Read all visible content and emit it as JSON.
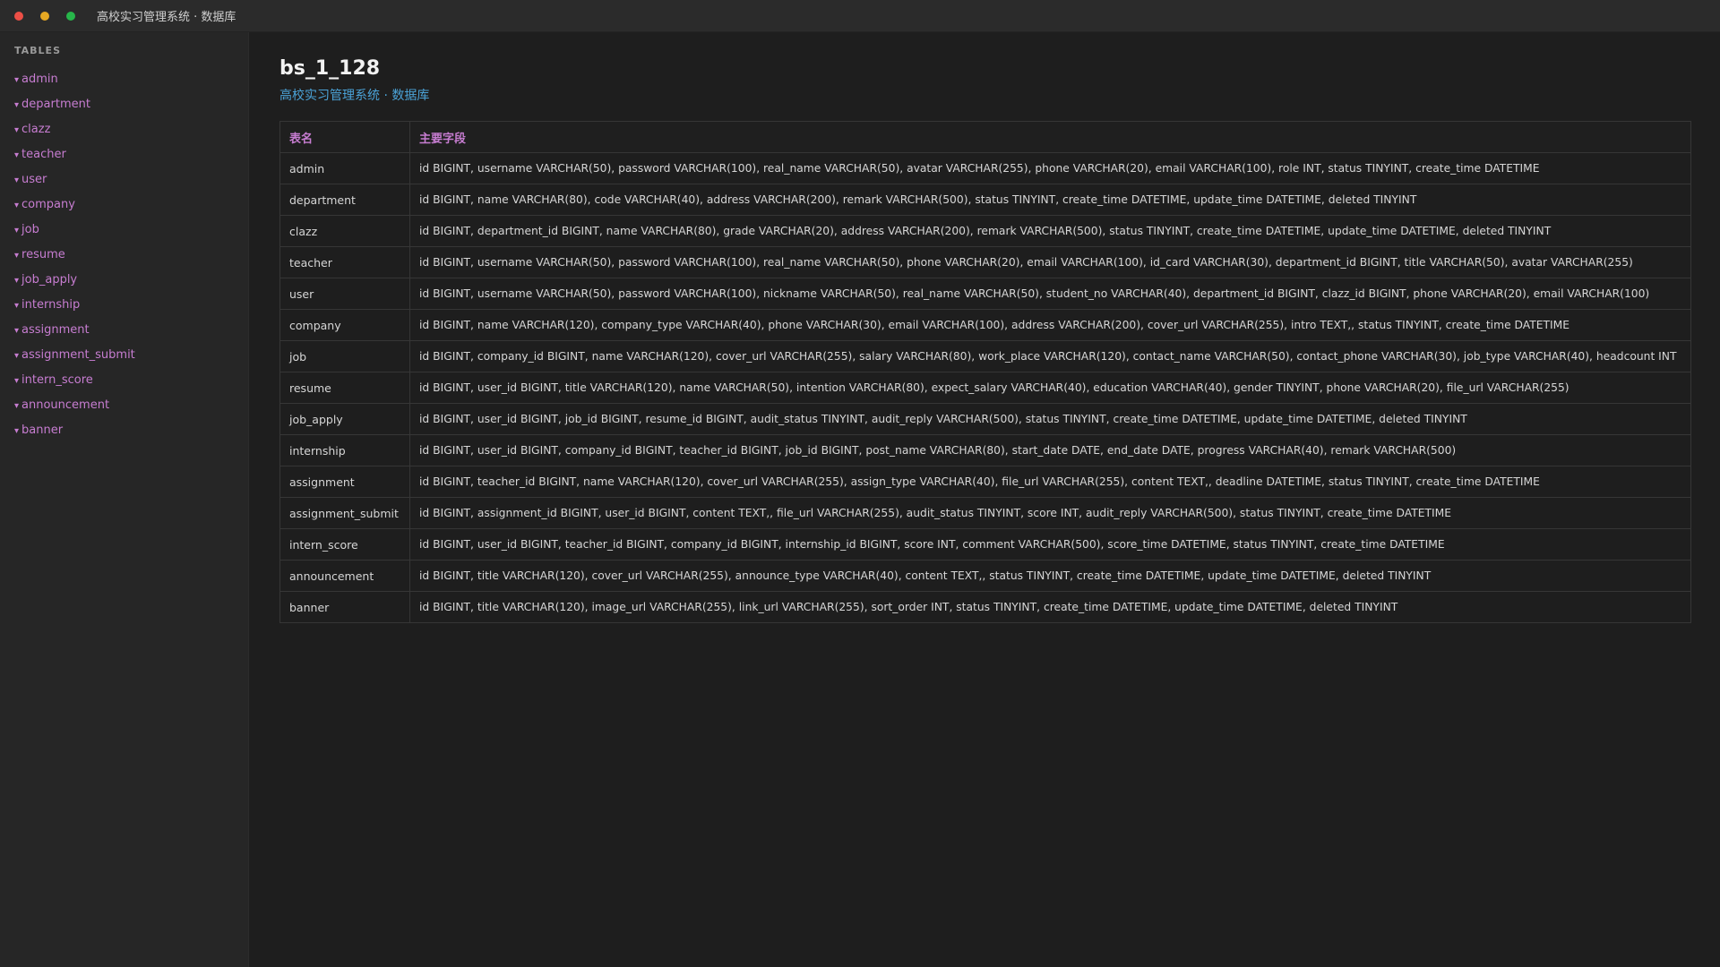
{
  "window": {
    "title": "高校实习管理系统 · 数据库"
  },
  "sidebar": {
    "heading": "TABLES",
    "caret_glyph": "▾",
    "items": [
      {
        "label": "admin"
      },
      {
        "label": "department"
      },
      {
        "label": "clazz"
      },
      {
        "label": "teacher"
      },
      {
        "label": "user"
      },
      {
        "label": "company"
      },
      {
        "label": "job"
      },
      {
        "label": "resume"
      },
      {
        "label": "job_apply"
      },
      {
        "label": "internship"
      },
      {
        "label": "assignment"
      },
      {
        "label": "assignment_submit"
      },
      {
        "label": "intern_score"
      },
      {
        "label": "announcement"
      },
      {
        "label": "banner"
      }
    ]
  },
  "main": {
    "db_name": "bs_1_128",
    "subtitle": "高校实习管理系统 · 数据库",
    "table": {
      "headers": {
        "name": "表名",
        "fields": "主要字段"
      },
      "rows": [
        {
          "name": "admin",
          "fields": "id BIGINT, username VARCHAR(50), password VARCHAR(100), real_name VARCHAR(50), avatar VARCHAR(255), phone VARCHAR(20), email VARCHAR(100), role INT, status TINYINT, create_time DATETIME"
        },
        {
          "name": "department",
          "fields": "id BIGINT, name VARCHAR(80), code VARCHAR(40), address VARCHAR(200), remark VARCHAR(500), status TINYINT, create_time DATETIME, update_time DATETIME, deleted TINYINT"
        },
        {
          "name": "clazz",
          "fields": "id BIGINT, department_id BIGINT, name VARCHAR(80), grade VARCHAR(20), address VARCHAR(200), remark VARCHAR(500), status TINYINT, create_time DATETIME, update_time DATETIME, deleted TINYINT"
        },
        {
          "name": "teacher",
          "fields": "id BIGINT, username VARCHAR(50), password VARCHAR(100), real_name VARCHAR(50), phone VARCHAR(20), email VARCHAR(100), id_card VARCHAR(30), department_id BIGINT, title VARCHAR(50), avatar VARCHAR(255)"
        },
        {
          "name": "user",
          "fields": "id BIGINT, username VARCHAR(50), password VARCHAR(100), nickname VARCHAR(50), real_name VARCHAR(50), student_no VARCHAR(40), department_id BIGINT, clazz_id BIGINT, phone VARCHAR(20), email VARCHAR(100)"
        },
        {
          "name": "company",
          "fields": "id BIGINT, name VARCHAR(120), company_type VARCHAR(40), phone VARCHAR(30), email VARCHAR(100), address VARCHAR(200), cover_url VARCHAR(255), intro TEXT,, status TINYINT, create_time DATETIME"
        },
        {
          "name": "job",
          "fields": "id BIGINT, company_id BIGINT, name VARCHAR(120), cover_url VARCHAR(255), salary VARCHAR(80), work_place VARCHAR(120), contact_name VARCHAR(50), contact_phone VARCHAR(30), job_type VARCHAR(40), headcount INT"
        },
        {
          "name": "resume",
          "fields": "id BIGINT, user_id BIGINT, title VARCHAR(120), name VARCHAR(50), intention VARCHAR(80), expect_salary VARCHAR(40), education VARCHAR(40), gender TINYINT, phone VARCHAR(20), file_url VARCHAR(255)"
        },
        {
          "name": "job_apply",
          "fields": "id BIGINT, user_id BIGINT, job_id BIGINT, resume_id BIGINT, audit_status TINYINT, audit_reply VARCHAR(500), status TINYINT, create_time DATETIME, update_time DATETIME, deleted TINYINT"
        },
        {
          "name": "internship",
          "fields": "id BIGINT, user_id BIGINT, company_id BIGINT, teacher_id BIGINT, job_id BIGINT, post_name VARCHAR(80), start_date DATE, end_date DATE, progress VARCHAR(40), remark VARCHAR(500)"
        },
        {
          "name": "assignment",
          "fields": "id BIGINT, teacher_id BIGINT, name VARCHAR(120), cover_url VARCHAR(255), assign_type VARCHAR(40), file_url VARCHAR(255), content TEXT,, deadline DATETIME, status TINYINT, create_time DATETIME"
        },
        {
          "name": "assignment_submit",
          "fields": "id BIGINT, assignment_id BIGINT, user_id BIGINT, content TEXT,, file_url VARCHAR(255), audit_status TINYINT, score INT, audit_reply VARCHAR(500), status TINYINT, create_time DATETIME"
        },
        {
          "name": "intern_score",
          "fields": "id BIGINT, user_id BIGINT, teacher_id BIGINT, company_id BIGINT, internship_id BIGINT, score INT, comment VARCHAR(500), score_time DATETIME, status TINYINT, create_time DATETIME"
        },
        {
          "name": "announcement",
          "fields": "id BIGINT, title VARCHAR(120), cover_url VARCHAR(255), announce_type VARCHAR(40), content TEXT,, status TINYINT, create_time DATETIME, update_time DATETIME, deleted TINYINT"
        },
        {
          "name": "banner",
          "fields": "id BIGINT, title VARCHAR(120), image_url VARCHAR(255), link_url VARCHAR(255), sort_order INT, status TINYINT, create_time DATETIME, update_time DATETIME, deleted TINYINT"
        }
      ]
    }
  },
  "colors": {
    "background": "#1e1e1e",
    "sidebar": "#262626",
    "accent_purple": "#c77dd1",
    "accent_blue": "#4ba3d8"
  }
}
